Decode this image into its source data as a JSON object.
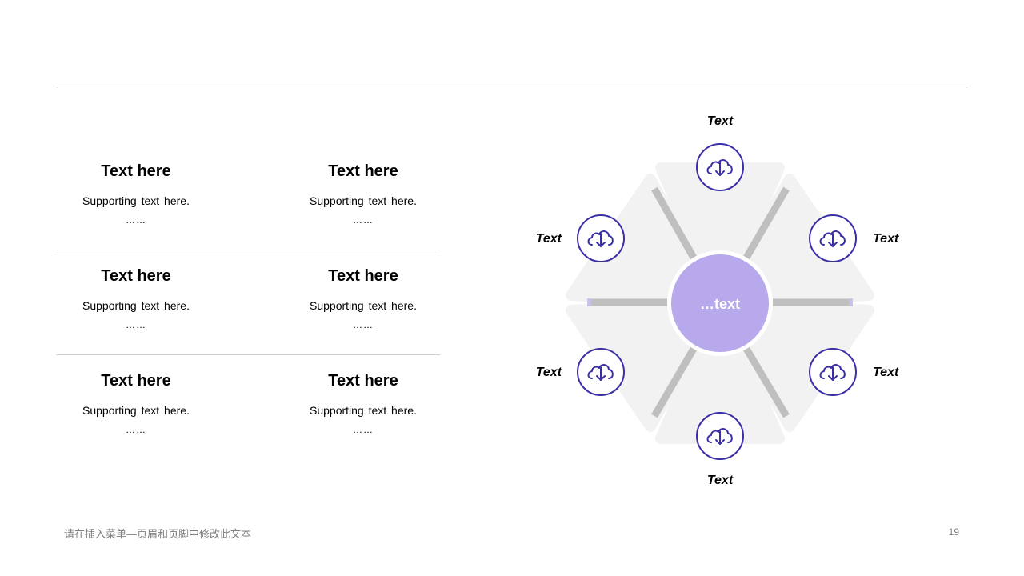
{
  "cells": [
    {
      "title": "Text here",
      "sub": "Supporting text here.",
      "dots": "……"
    },
    {
      "title": "Text here",
      "sub": "Supporting text here.",
      "dots": "……"
    },
    {
      "title": "Text here",
      "sub": "Supporting text here.",
      "dots": "……"
    },
    {
      "title": "Text here",
      "sub": "Supporting text here.",
      "dots": "……"
    },
    {
      "title": "Text here",
      "sub": "Supporting text here.",
      "dots": "……"
    },
    {
      "title": "Text here",
      "sub": "Supporting text here.",
      "dots": "……"
    }
  ],
  "diagram": {
    "center": "…text",
    "labels": [
      "Text",
      "Text",
      "Text",
      "Text",
      "Text",
      "Text"
    ],
    "icon": "cloud-download-icon",
    "colors": {
      "accent": "#3a2fa6",
      "center_fill": "#b7a9eb",
      "panel": "#f2f2f2",
      "spoke": "#bfbfbf"
    }
  },
  "footer": {
    "text": "请在插入菜单—页眉和页脚中修改此文本",
    "page": "19"
  }
}
